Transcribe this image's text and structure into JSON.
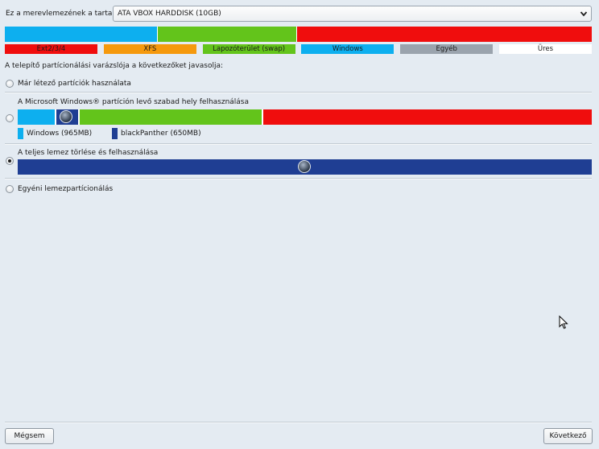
{
  "disk": {
    "label": "Ez a merevlemezének a tartalma",
    "selected": "ATA VBOX HARDDISK (10GB)"
  },
  "current_layout": [
    {
      "name": "Windows",
      "fraction": 0.26,
      "color": "#0dafef"
    },
    {
      "name": "Lapozóterület (swap)",
      "fraction": 0.237,
      "color": "#63c41b"
    },
    {
      "name": "Ext2/3/4",
      "fraction": 0.503,
      "color": "#f00d0d"
    }
  ],
  "legend": [
    {
      "label": "Ext2/3/4",
      "bg": "#f00d0d",
      "fg": "#1a1a1a"
    },
    {
      "label": "XFS",
      "bg": "#f5990d",
      "fg": "#1a1a1a"
    },
    {
      "label": "Lapozóterület (swap)",
      "bg": "#63c41b",
      "fg": "#1a1a1a"
    },
    {
      "label": "Windows",
      "bg": "#0dafef",
      "fg": "#1a1a1a"
    },
    {
      "label": "Egyéb",
      "bg": "#9aa3ad",
      "fg": "#1a1a1a"
    },
    {
      "label": "Üres",
      "bg": "#ffffff",
      "fg": "#1a1a1a"
    }
  ],
  "wizard_text": "A telepítő partícionálási varázslója a következőket javasolja:",
  "options": {
    "existing": {
      "label": "Már létező partíciók használata",
      "checked": false
    },
    "windows": {
      "label": "A Microsoft Windows® partíción levő szabad hely felhasználása",
      "checked": false,
      "layout": [
        {
          "name": "Windows",
          "fraction": 0.065,
          "color": "#0dafef"
        },
        {
          "name": "blackPanther",
          "fraction": 0.04,
          "color": "#1f3e93"
        },
        {
          "name": "Lapozóterület (swap)",
          "fraction": 0.32,
          "color": "#63c41b"
        },
        {
          "name": "Ext2/3/4",
          "fraction": 0.575,
          "color": "#f00d0d"
        }
      ],
      "resize_legend": [
        {
          "label": "Windows (965MB)",
          "color": "#0dafef"
        },
        {
          "label": "blackPanther (650MB)",
          "color": "#1f3e93"
        }
      ]
    },
    "erase": {
      "label": "A teljes lemez törlése és felhasználása",
      "checked": true,
      "color": "#1f3e93"
    },
    "custom": {
      "label": "Egyéni lemezpartícionálás",
      "checked": false
    }
  },
  "buttons": {
    "cancel": "Mégsem",
    "next": "Következő"
  }
}
